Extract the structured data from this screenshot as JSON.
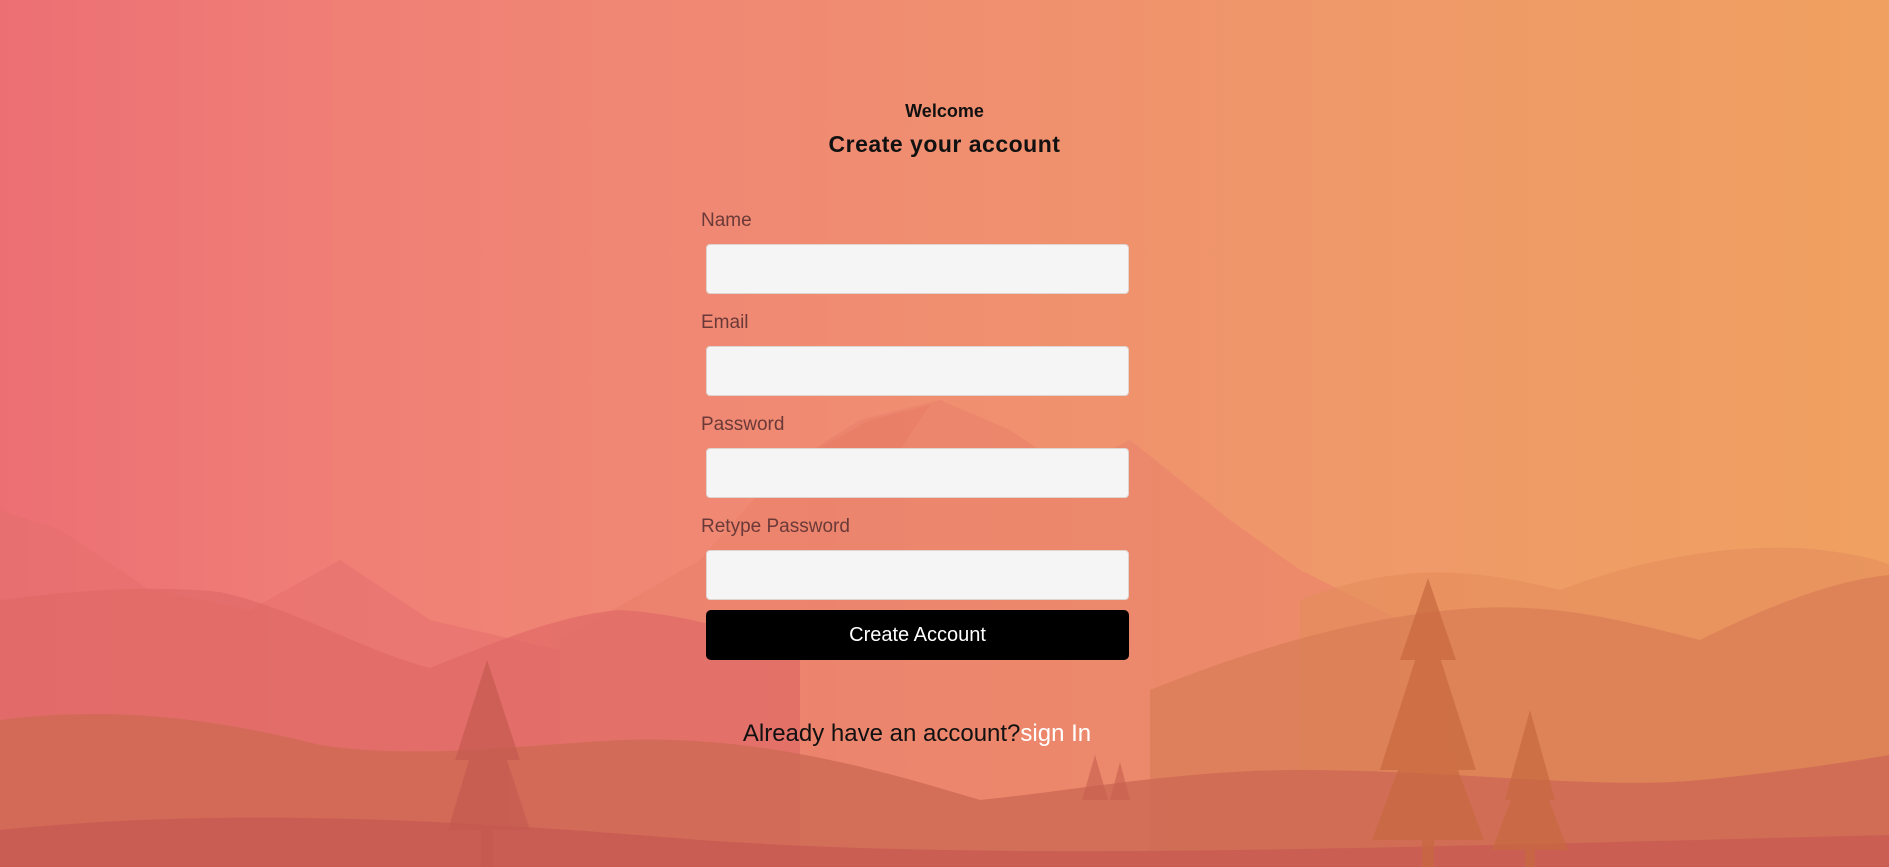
{
  "colors": {
    "background_left": "#ec6f74",
    "background_right": "#f0a060",
    "input_background": "#f5f5f5",
    "button_background": "#000000",
    "button_text": "#ffffff",
    "link_text": "#ffffff"
  },
  "header": {
    "welcome": "Welcome",
    "title": "Create your account"
  },
  "form": {
    "fields": [
      {
        "label": "Name",
        "value": "",
        "type": "text"
      },
      {
        "label": "Email",
        "value": "",
        "type": "email"
      },
      {
        "label": "Password",
        "value": "",
        "type": "password"
      },
      {
        "label": "Retype Password",
        "value": "",
        "type": "password"
      }
    ],
    "submit_label": "Create Account"
  },
  "footer": {
    "prompt": "Already have an account?",
    "link_label": "sign In"
  }
}
